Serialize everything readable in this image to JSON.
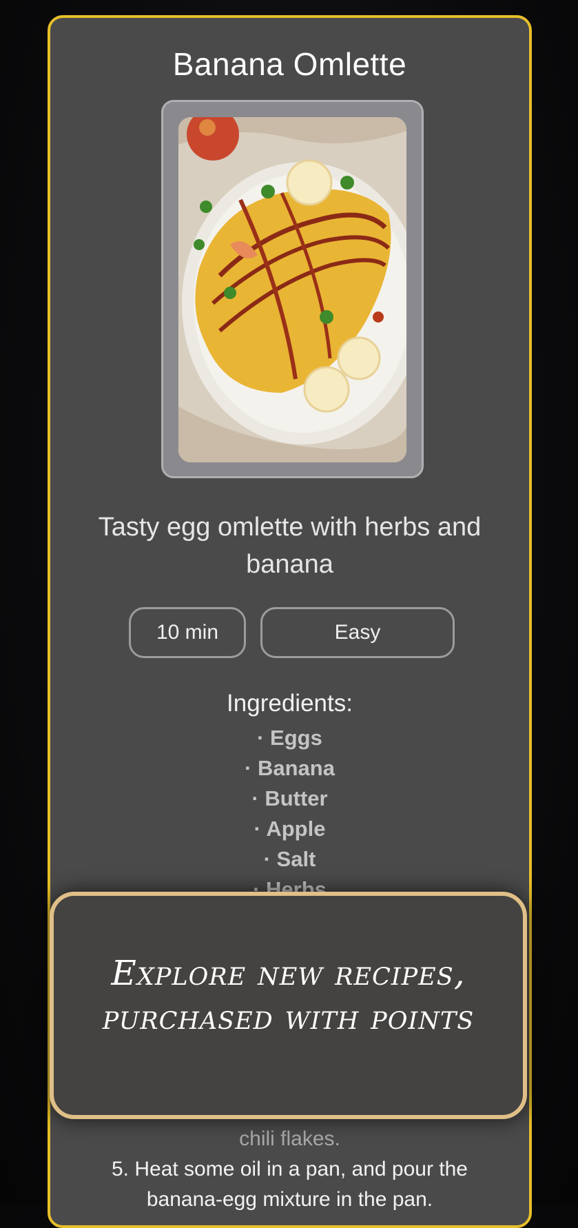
{
  "recipe": {
    "title": "Banana Omlette",
    "description": "Tasty egg omlette with herbs and banana",
    "time": "10 min",
    "difficulty": "Easy",
    "ingredients_heading": "Ingredients:",
    "ingredients": [
      "· Eggs",
      "· Banana",
      "· Butter",
      "· Apple",
      "· Salt",
      "· Herbs"
    ],
    "steps_partial": [
      "chili flakes.",
      "5. Heat some oil in a pan, and pour the banana-egg mixture in the pan."
    ]
  },
  "overlay": {
    "line1": "Explore new recipes,",
    "line2": "purchased with points"
  },
  "colors": {
    "card_border": "#e7bf2a",
    "overlay_border": "#e0bf88",
    "card_bg": "#4a4a4a"
  },
  "image": {
    "icon": "omelette-photo"
  }
}
